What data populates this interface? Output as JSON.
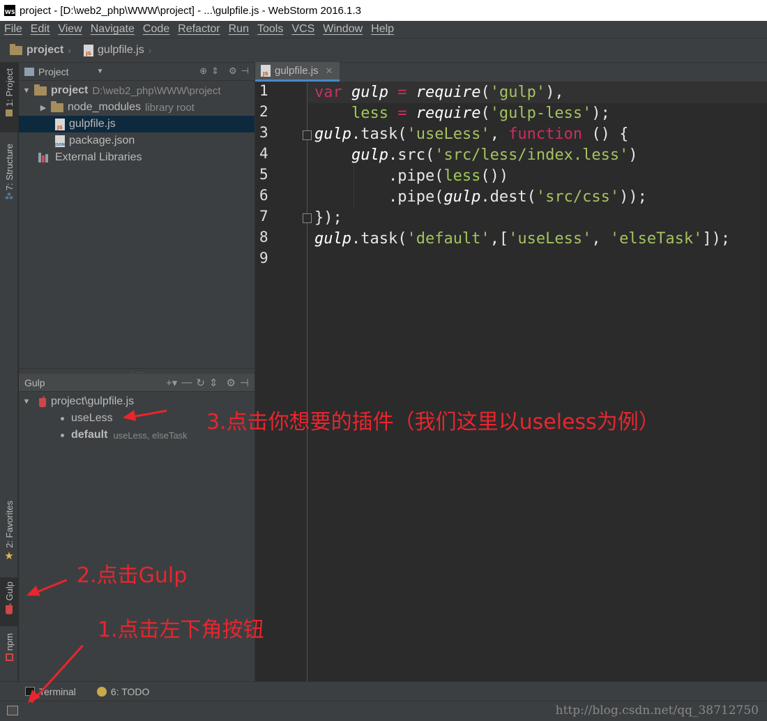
{
  "window": {
    "title": "project - [D:\\web2_php\\WWW\\project] - ...\\gulpfile.js - WebStorm 2016.1.3",
    "logo_text": "WS"
  },
  "menu": [
    "File",
    "Edit",
    "View",
    "Navigate",
    "Code",
    "Refactor",
    "Run",
    "Tools",
    "VCS",
    "Window",
    "Help"
  ],
  "breadcrumbs": {
    "project": "project",
    "file": "gulpfile.js"
  },
  "left_stripe": {
    "project_tab": "1: Project",
    "structure_tab": "7: Structure",
    "favorites_tab": "2: Favorites",
    "gulp_tab": "Gulp",
    "npm_tab": "npm"
  },
  "project_panel": {
    "title": "Project",
    "tree": {
      "root_name": "project",
      "root_path": "D:\\web2_php\\WWW\\project",
      "node_modules": "node_modules",
      "node_modules_hint": "library root",
      "gulpfile": "gulpfile.js",
      "package": "package.json",
      "external": "External Libraries"
    }
  },
  "gulp_panel": {
    "title": "Gulp",
    "file": "project\\gulpfile.js",
    "tasks": [
      {
        "name": "useLess",
        "deps": ""
      },
      {
        "name": "default",
        "deps": "useLess, elseTask"
      }
    ]
  },
  "editor": {
    "tab_label": "gulpfile.js",
    "line_numbers": [
      "1",
      "2",
      "3",
      "4",
      "5",
      "6",
      "7",
      "8",
      "9"
    ]
  },
  "bottom_tools": {
    "terminal": "Terminal",
    "todo": "6: TODO"
  },
  "annotations": {
    "step1": "1.点击左下角按钮",
    "step2": "2.点击Gulp",
    "step3": "3.点击你想要的插件（我们这里以useless为例）"
  },
  "watermark": "http://blog.csdn.net/qq_38712750",
  "colors": {
    "annotation": "#e8262e",
    "keyword": "#cc2f5e",
    "string": "#a5c261",
    "selection": "#0d293e"
  }
}
